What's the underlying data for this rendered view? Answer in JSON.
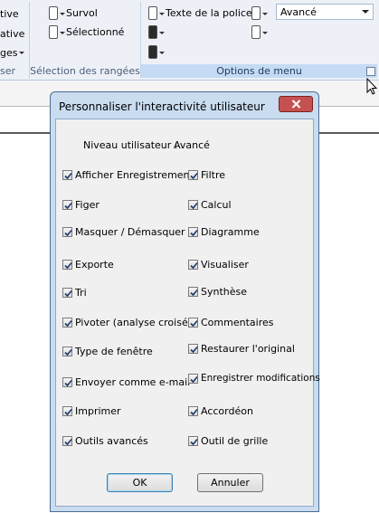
{
  "ribbon": {
    "left_group": {
      "items": [
        "tive",
        "ative",
        "ges"
      ],
      "title": "ser"
    },
    "selection_group": {
      "survol": "Survol",
      "selectionne": "Sélectionné",
      "title": "Sélection des rangées"
    },
    "menu_options_group": {
      "font_text": "Texte de la police",
      "dropdown_value": "Avancé",
      "title": "Options de menu"
    }
  },
  "dialog": {
    "title": "Personnaliser l'interactivité utilisateur",
    "level_label": "Niveau utilisateur :",
    "level_value": "Avancé",
    "left_options": [
      {
        "label": "Afficher Enregistrements",
        "checked": true
      },
      {
        "label": "Figer",
        "checked": true
      },
      {
        "label": "Masquer / Démasquer",
        "checked": true
      },
      {
        "label": "Exporte",
        "checked": true
      },
      {
        "label": "Tri",
        "checked": true
      },
      {
        "label": "Pivoter (analyse croisée)",
        "checked": true
      },
      {
        "label": "Type de fenêtre",
        "checked": true
      },
      {
        "label": "Envoyer comme e-mail",
        "checked": true
      },
      {
        "label": "Imprimer",
        "checked": true
      },
      {
        "label": "Outils avancés",
        "checked": true
      }
    ],
    "right_options": [
      {
        "label": "Filtre",
        "checked": true
      },
      {
        "label": "Calcul",
        "checked": true
      },
      {
        "label": "Diagramme",
        "checked": true
      },
      {
        "label": "Visualiser",
        "checked": true
      },
      {
        "label": "Synthèse",
        "checked": true
      },
      {
        "label": "Commentaires",
        "checked": true
      },
      {
        "label": "Restaurer l'original",
        "checked": true
      },
      {
        "label": "Enregistrer modifications",
        "checked": true
      },
      {
        "label": "Accordéon",
        "checked": true
      },
      {
        "label": "Outil de grille",
        "checked": true
      }
    ],
    "ok_label": "OK",
    "cancel_label": "Annuler"
  },
  "colors": {
    "ribbon_bg": "#edf1f7",
    "dialog_frame": "#c9dcf0",
    "close_button": "#c75050"
  }
}
